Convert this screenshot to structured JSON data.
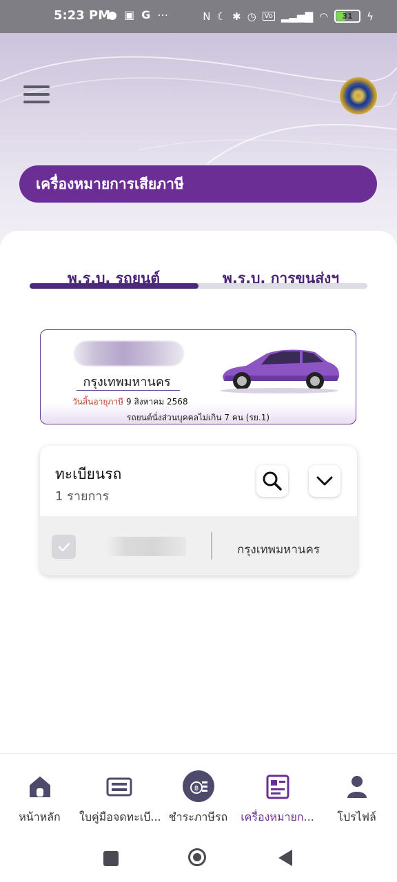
{
  "status_bar": {
    "time": "5:23 PM",
    "left_icons": [
      "chat-icon",
      "shopping-bag-icon",
      "google-icon",
      "more-icon"
    ],
    "right_icons": [
      "nfc-icon",
      "moon-icon",
      "bluetooth-icon",
      "alarm-icon",
      "volte-icon",
      "signal-icon",
      "wifi-icon"
    ],
    "battery": "31"
  },
  "header": {
    "menu_icon": "hamburger-icon",
    "emblem": "government-emblem",
    "title": "เครื่องหมายการเสียภาษี"
  },
  "tabs": [
    {
      "label": "พ.ร.บ. รถยนต์",
      "active": true
    },
    {
      "label": "พ.ร.บ. การขนส่งฯ",
      "active": false
    }
  ],
  "plate_card": {
    "province": "กรุงเทพมหานคร",
    "expiry_label": "วันสิ้นอายุภาษี",
    "expiry_date": "9 สิงหาคม 2568",
    "vehicle_type": "รถยนต์นั่งส่วนบุคคลไม่เกิน 7 คน (รย.1)"
  },
  "registration": {
    "title": "ทะเบียนรถ",
    "count": "1 รายการ",
    "rows": [
      {
        "province": "กรุงเทพมหานคร",
        "checked": true
      }
    ]
  },
  "bottom_nav": [
    {
      "label": "หน้าหลัก",
      "icon": "home-icon",
      "active": false
    },
    {
      "label": "ใบคู่มือจดทะเบี...",
      "icon": "vehicle-book-icon",
      "active": false
    },
    {
      "label": "ชำระภาษีรถ",
      "icon": "tax-payment-icon",
      "active": false
    },
    {
      "label": "เครื่องหมายก...",
      "icon": "tax-sticker-icon",
      "active": true
    },
    {
      "label": "โปรไฟล์",
      "icon": "profile-icon",
      "active": false
    }
  ],
  "colors": {
    "brand_purple": "#6a2e95",
    "tab_active": "#4b2a7b",
    "expiry_red": "#c0392b"
  }
}
